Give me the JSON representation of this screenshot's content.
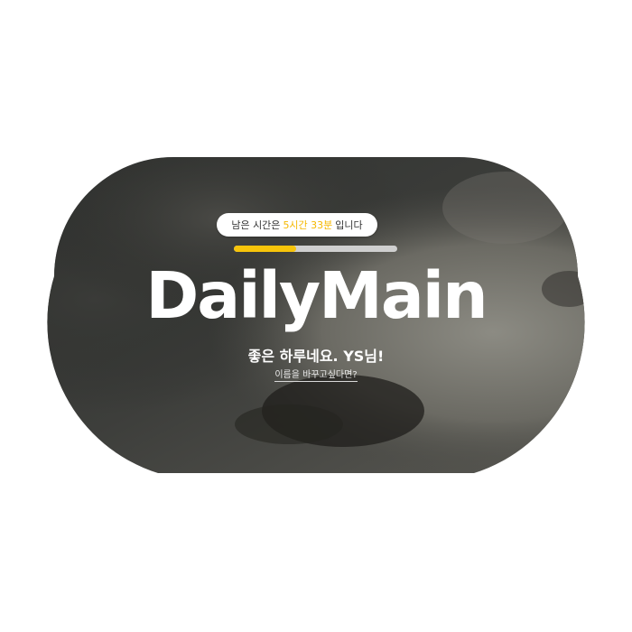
{
  "timer": {
    "prefix": "남은 시간은",
    "remaining": "5시간 33분",
    "suffix": "입니다",
    "progress_fraction": 0.38,
    "accent_color": "#f7c40a"
  },
  "brand": {
    "title": "DailyMain"
  },
  "greeting": {
    "text": "좋은 하루네요. YS님!",
    "rename_link": "이름을 바꾸고싶다면?"
  },
  "background": {
    "shape": "cloud",
    "image": "blurred dark photo"
  }
}
